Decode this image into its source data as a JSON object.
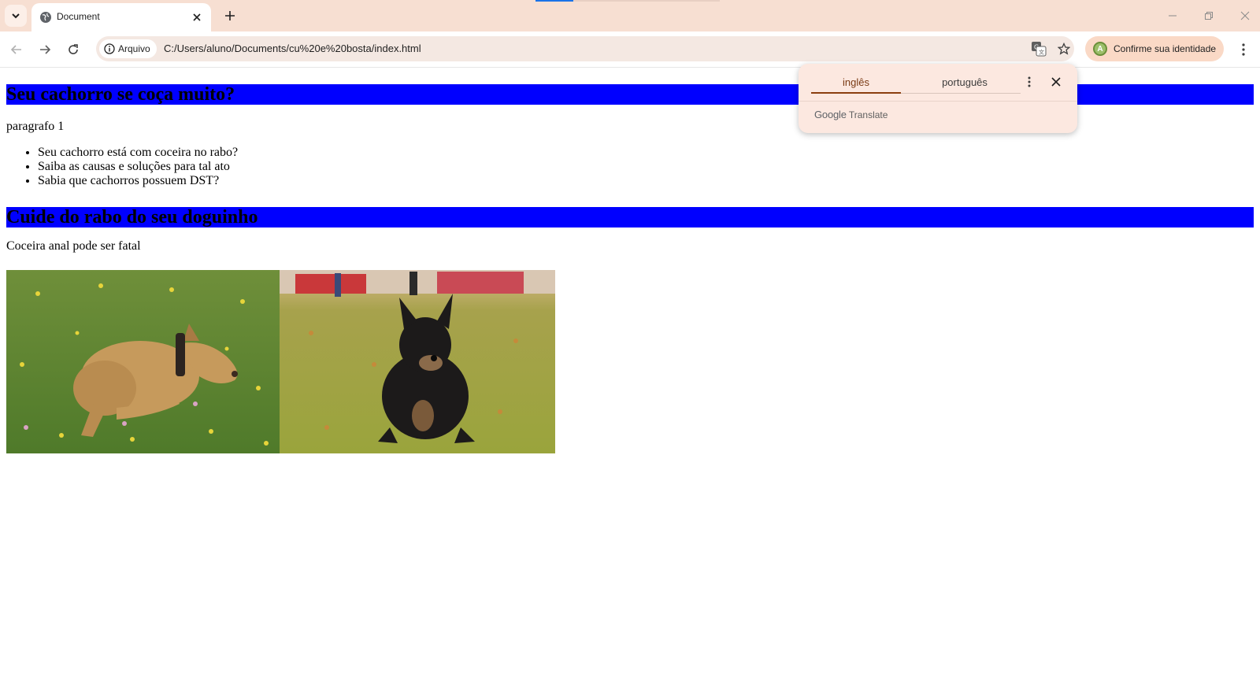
{
  "browser": {
    "tab": {
      "title": "Document"
    },
    "address": {
      "site_chip": "Arquivo",
      "url": "C:/Users/aluno/Documents/cu%20e%20bosta/index.html"
    },
    "identity_button": "Confirme sua identidade",
    "avatar_letter": "A"
  },
  "translate_popup": {
    "lang_source": "inglês",
    "lang_target": "português",
    "brand_google": "Google",
    "brand_translate": "Translate"
  },
  "page": {
    "heading1": "Seu cachorro se coça muito?",
    "paragraph1": "paragrafo 1",
    "list": [
      "Seu cachorro está com coceira no rabo?",
      "Saiba as causas e soluções para tal ato",
      "Sabia que cachorros possuem DST?"
    ],
    "heading2": "Cuide do rabo do seu doguinho",
    "paragraph2": "Coceira anal pode ser fatal"
  },
  "colors": {
    "heading_bg": "#0000ff",
    "tabstrip_bg": "#f7dfd2",
    "accent": "#8b3e0f"
  }
}
